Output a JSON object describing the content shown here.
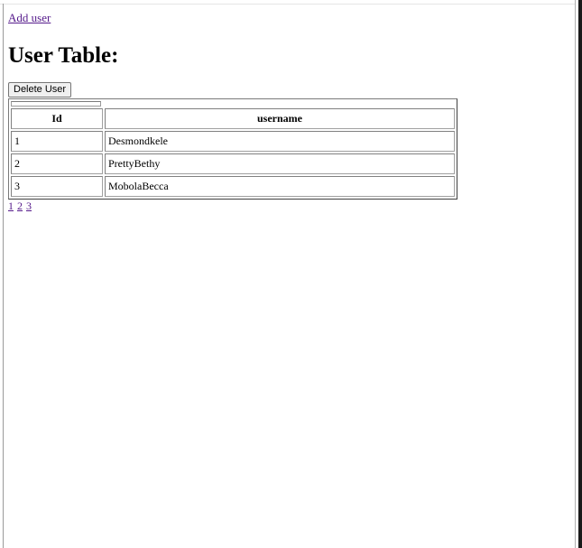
{
  "nav": {
    "add_user_label": "Add user"
  },
  "page": {
    "title": "User Table:"
  },
  "actions": {
    "delete_user_label": "Delete User"
  },
  "table": {
    "columns": [
      "Id",
      "username"
    ],
    "rows": [
      {
        "id": "1",
        "username": "Desmondkele"
      },
      {
        "id": "2",
        "username": "PrettyBethy"
      },
      {
        "id": "3",
        "username": "MobolaBecca"
      }
    ]
  },
  "pagination": {
    "pages": [
      "1",
      "2",
      "3"
    ]
  },
  "colors": {
    "visited_link": "#551a8b",
    "button_bg": "#f0f0f0"
  }
}
